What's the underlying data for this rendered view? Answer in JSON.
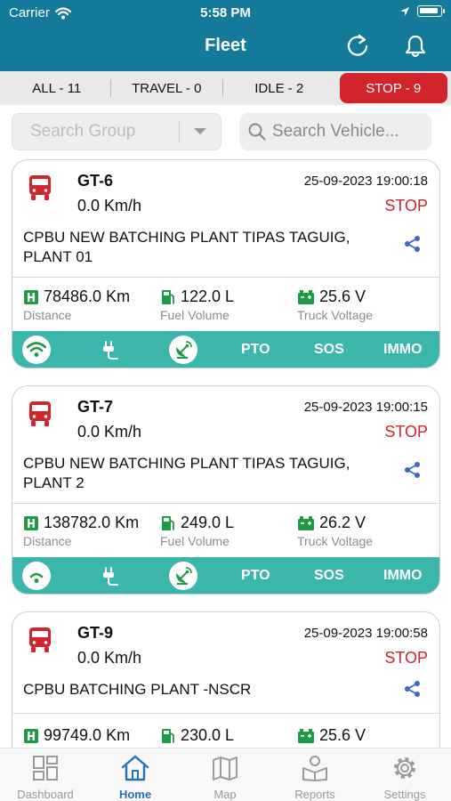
{
  "status_bar": {
    "carrier": "Carrier",
    "time": "5:58 PM"
  },
  "header": {
    "title": "Fleet"
  },
  "filters": [
    {
      "label": "ALL - 11",
      "active": false
    },
    {
      "label": "TRAVEL - 0",
      "active": false
    },
    {
      "label": "IDLE - 2",
      "active": false
    },
    {
      "label": "STOP - 9",
      "active": true
    }
  ],
  "search": {
    "group_placeholder": "Search Group",
    "vehicle_placeholder": "Search Vehicle..."
  },
  "colors": {
    "header": "#147a99",
    "stop_red": "#d1252b",
    "teal": "#3ab6aa",
    "green": "#1f9b45",
    "active_tab": "#1f72b8"
  },
  "vehicles": [
    {
      "name": "GT-6",
      "speed": "0.0 Km/h",
      "datetime": "25-09-2023 19:00:18",
      "status": "STOP",
      "address": "CPBU NEW BATCHING PLANT TIPAS TAGUIG, PLANT 01",
      "distance": "78486.0 Km",
      "fuel": "122.0 L",
      "voltage": "25.6 V",
      "distance_label": "Distance",
      "fuel_label": "Fuel Volume",
      "voltage_label": "Truck Voltage",
      "pto": "PTO",
      "sos": "SOS",
      "immo": "IMMO"
    },
    {
      "name": "GT-7",
      "speed": "0.0 Km/h",
      "datetime": "25-09-2023 19:00:15",
      "status": "STOP",
      "address": "CPBU NEW BATCHING PLANT TIPAS TAGUIG, PLANT 2",
      "distance": "138782.0 Km",
      "fuel": "249.0 L",
      "voltage": "26.2 V",
      "distance_label": "Distance",
      "fuel_label": "Fuel Volume",
      "voltage_label": "Truck Voltage",
      "pto": "PTO",
      "sos": "SOS",
      "immo": "IMMO"
    },
    {
      "name": "GT-9",
      "speed": "0.0 Km/h",
      "datetime": "25-09-2023 19:00:58",
      "status": "STOP",
      "address": "CPBU BATCHING PLANT -NSCR",
      "distance": "99749.0 Km",
      "fuel": "230.0 L",
      "voltage": "25.6 V"
    }
  ],
  "tabs": [
    {
      "label": "Dashboard",
      "icon": "dashboard-icon",
      "active": false
    },
    {
      "label": "Home",
      "icon": "home-icon",
      "active": true
    },
    {
      "label": "Map",
      "icon": "map-icon",
      "active": false
    },
    {
      "label": "Reports",
      "icon": "reports-icon",
      "active": false
    },
    {
      "label": "Settings",
      "icon": "gear-icon",
      "active": false
    }
  ]
}
